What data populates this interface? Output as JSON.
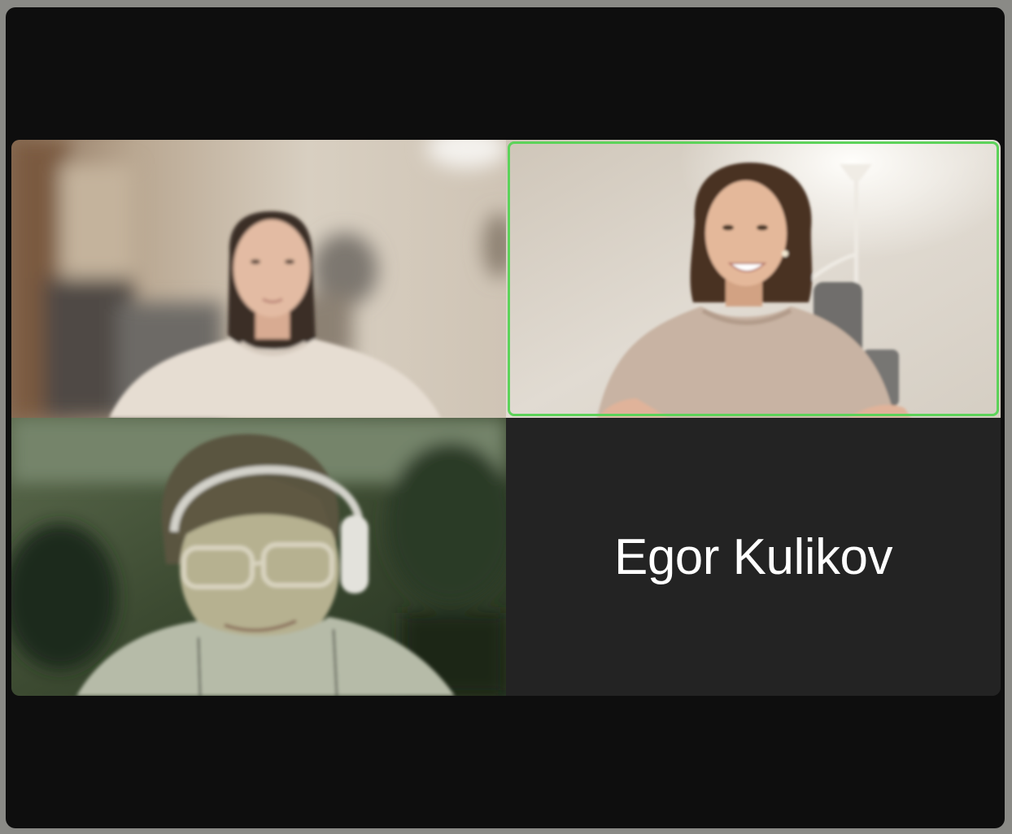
{
  "participants": [
    {
      "id": "p1",
      "video": "on",
      "icon": "video-feed"
    },
    {
      "id": "p2",
      "video": "on",
      "icon": "video-feed",
      "active_speaker": true
    },
    {
      "id": "p3",
      "video": "on",
      "icon": "video-feed"
    },
    {
      "id": "p4",
      "video": "off",
      "name": "Egor Kulikov"
    }
  ],
  "colors": {
    "active_speaker_border": "#5dd35a",
    "window_background": "#0e0e0e",
    "video_off_tile": "#232323"
  }
}
